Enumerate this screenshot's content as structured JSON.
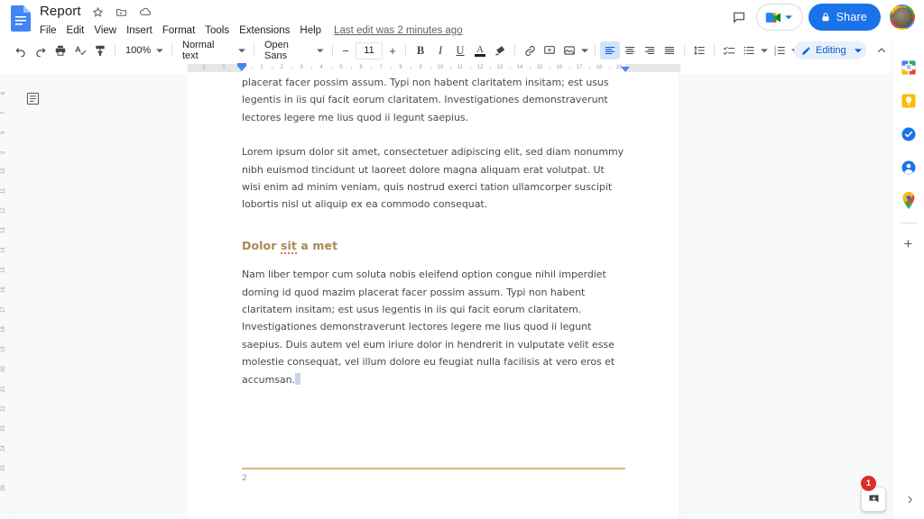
{
  "header": {
    "doc_title": "Report",
    "title_icons": [
      "star-icon",
      "move-to-folder-icon",
      "cloud-saved-icon"
    ],
    "menus": [
      "File",
      "Edit",
      "View",
      "Insert",
      "Format",
      "Tools",
      "Extensions",
      "Help"
    ],
    "last_edit": "Last edit was 2 minutes ago",
    "comment_history_label": "",
    "meet_label": "",
    "share_label": "Share"
  },
  "toolbar": {
    "undo": "undo-icon",
    "redo": "redo-icon",
    "print": "print-icon",
    "spellcheck": "spellcheck-icon",
    "paint_format": "paint-format-icon",
    "zoom_value": "100%",
    "style_value": "Normal text",
    "font_value": "Open Sans",
    "font_size": "11",
    "decrease_font": "−",
    "increase_font": "+",
    "bold": "B",
    "italic": "I",
    "underline": "U",
    "text_color": "A",
    "highlight": "highlight-icon",
    "link": "link-icon",
    "insert_comment": "insert-comment-icon",
    "insert_image": "insert-image-icon",
    "align_left": "align-left-icon",
    "align_center": "align-center-icon",
    "align_right": "align-right-icon",
    "align_justify": "align-justify-icon",
    "line_spacing": "line-spacing-icon",
    "checklist": "checklist-icon",
    "bulleted_list": "bulleted-list-icon",
    "numbered_list": "numbered-list-icon",
    "decrease_indent": "decrease-indent-icon",
    "increase_indent": "increase-indent-icon",
    "clear_formatting": "clear-formatting-icon",
    "mode_label": "Editing",
    "collapse": "collapse-toolbar-icon"
  },
  "ruler": {
    "left_labels": [
      "2",
      "1"
    ],
    "labels": [
      "1",
      "2",
      "3",
      "4",
      "5",
      "6",
      "7",
      "8",
      "9",
      "10",
      "11",
      "12",
      "13",
      "14",
      "15",
      "16",
      "17",
      "18",
      "19"
    ],
    "vertical_labels": [
      "6",
      "7",
      "8",
      "9",
      "10",
      "11",
      "12",
      "13",
      "14",
      "15",
      "16",
      "17",
      "18",
      "19",
      "20",
      "21",
      "22",
      "23",
      "24",
      "25",
      "26"
    ]
  },
  "left_pane": {
    "outline_toggle": "show-document-outline-icon"
  },
  "document": {
    "paragraphs": [
      {
        "id": "p1",
        "text": "placerat facer possim assum. Typi non habent claritatem insitam; est usus legentis in iis qui facit eorum claritatem. Investigationes demonstraverunt lectores legere me lius quod ii legunt saepius."
      },
      {
        "id": "p2",
        "text": "Lorem ipsum dolor sit amet, consectetuer adipiscing elit, sed diam nonummy nibh euismod tincidunt ut laoreet dolore magna aliquam erat volutpat. Ut wisi enim ad minim veniam, quis nostrud exerci tation ullamcorper suscipit lobortis nisl ut aliquip ex ea commodo consequat."
      }
    ],
    "heading": {
      "before": "Dolor ",
      "misspelled": "sit",
      "after": " a met",
      "color": "#a68b52"
    },
    "last_paragraph": {
      "text": "Nam liber tempor cum soluta nobis eleifend option congue nihil imperdiet doming id quod mazim placerat facer possim assum. Typi non habent claritatem insitam; est usus legentis in iis qui facit eorum claritatem. Investigationes demonstraverunt lectores legere me lius quod ii legunt saepius. Duis autem vel eum iriure dolor in hendrerit in vulputate velit esse molestie consequat, vel illum dolore eu feugiat nulla facilisis at vero eros et accumsan."
    },
    "footer_rule_color": "#dcb678",
    "page_number": "2"
  },
  "right_sidebar": {
    "items": [
      {
        "name": "google-calendar-icon",
        "label": "Calendar"
      },
      {
        "name": "google-keep-icon",
        "label": "Keep"
      },
      {
        "name": "google-tasks-icon",
        "label": "Tasks"
      },
      {
        "name": "google-contacts-icon",
        "label": "Contacts"
      },
      {
        "name": "google-maps-icon",
        "label": "Maps"
      }
    ],
    "add_label": "+",
    "expand_chevron": "chevron-right-icon"
  },
  "floating": {
    "explore_badge": "1",
    "explore_icon": "explore-icon"
  },
  "colors": {
    "accent_blue": "#1a73e8",
    "active_tool_bg": "#d3e3fd",
    "mode_pill_bg": "#e8f0fe",
    "badge_red": "#d93025",
    "heading_brown": "#a68b52",
    "footer_rule": "#dcb678",
    "canvas_bg": "#f8f9fa"
  }
}
